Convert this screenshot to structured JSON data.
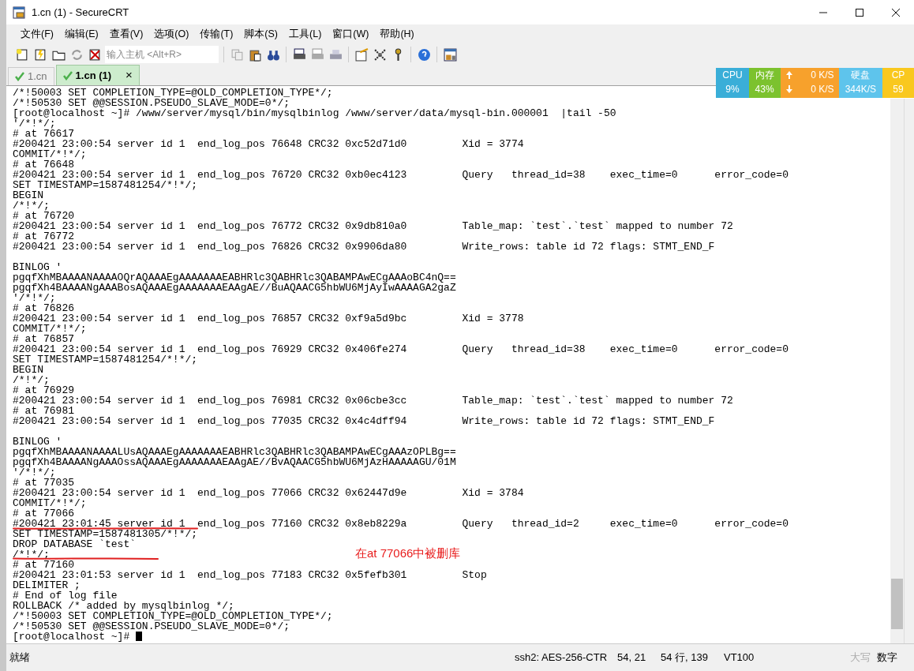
{
  "window": {
    "title": "1.cn (1) - SecureCRT"
  },
  "menu": [
    "文件(F)",
    "编辑(E)",
    "查看(V)",
    "选项(O)",
    "传输(T)",
    "脚本(S)",
    "工具(L)",
    "窗口(W)",
    "帮助(H)"
  ],
  "toolbar": {
    "host_field": {
      "placeholder": "输入主机 <Alt+R>"
    }
  },
  "tabs": [
    {
      "label": "1.cn",
      "selected": false,
      "connected": true
    },
    {
      "label": "1.cn (1)",
      "selected": true,
      "connected": true,
      "close": "×"
    }
  ],
  "monitor": [
    {
      "kind": "meter",
      "label": "CPU",
      "value": "9%",
      "color": "#3aaed8"
    },
    {
      "kind": "meter",
      "label": "内存",
      "value": "43%",
      "color": "#7cc22e"
    },
    {
      "kind": "network",
      "up": "0 K/S",
      "down": "0 K/S",
      "color": "#f7a12c"
    },
    {
      "kind": "meter",
      "label": "硬盘",
      "value": "344K/S",
      "color": "#5ec4ec"
    },
    {
      "kind": "meter",
      "label": "CP",
      "value": "59",
      "color": "#f9c81e"
    }
  ],
  "terminal": {
    "lines": [
      {
        "text": "/*!50003 SET COMPLETION_TYPE=@OLD_COMPLETION_TYPE*/;"
      },
      {
        "text": "/*!50530 SET @@SESSION.PSEUDO_SLAVE_MODE=0*/;"
      },
      {
        "text": "[root@localhost ~]# /www/server/mysql/bin/mysqlbinlog /www/server/data/mysql-bin.000001  |tail -50"
      },
      {
        "text": "'/*!*/;"
      },
      {
        "text": "# at 76617"
      },
      {
        "text": "#200421 23:00:54 server id 1  end_log_pos 76648 CRC32 0xc52d71d0         Xid = 3774"
      },
      {
        "text": "COMMIT/*!*/;"
      },
      {
        "text": "# at 76648"
      },
      {
        "text": "#200421 23:00:54 server id 1  end_log_pos 76720 CRC32 0xb0ec4123         Query   thread_id=38    exec_time=0      error_code=0"
      },
      {
        "text": "SET TIMESTAMP=1587481254/*!*/;"
      },
      {
        "text": "BEGIN"
      },
      {
        "text": "/*!*/;"
      },
      {
        "text": "# at 76720"
      },
      {
        "text": "#200421 23:00:54 server id 1  end_log_pos 76772 CRC32 0x9db810a0         Table_map: `test`.`test` mapped to number 72"
      },
      {
        "text": "# at 76772"
      },
      {
        "text": "#200421 23:00:54 server id 1  end_log_pos 76826 CRC32 0x9906da80         Write_rows: table id 72 flags: STMT_END_F"
      },
      {
        "text": "BINLOG '",
        "gap_before": true
      },
      {
        "text": "pgqfXhMBAAAANAAAAOQrAQAAAEgAAAAAAAEABHRlc3QABHRlc3QABAMPAwECgAAAoBC4nQ=="
      },
      {
        "text": "pgqfXh4BAAAANgAAABosAQAAAEgAAAAAAAEAAgAE//BuAQAACG5hbWU6MjAyIwAAAAGA2gaZ"
      },
      {
        "text": "'/*!*/;"
      },
      {
        "text": "# at 76826"
      },
      {
        "text": "#200421 23:00:54 server id 1  end_log_pos 76857 CRC32 0xf9a5d9bc         Xid = 3778"
      },
      {
        "text": "COMMIT/*!*/;"
      },
      {
        "text": "# at 76857"
      },
      {
        "text": "#200421 23:00:54 server id 1  end_log_pos 76929 CRC32 0x406fe274         Query   thread_id=38    exec_time=0      error_code=0"
      },
      {
        "text": "SET TIMESTAMP=1587481254/*!*/;"
      },
      {
        "text": "BEGIN"
      },
      {
        "text": "/*!*/;"
      },
      {
        "text": "# at 76929"
      },
      {
        "text": "#200421 23:00:54 server id 1  end_log_pos 76981 CRC32 0x06cbe3cc         Table_map: `test`.`test` mapped to number 72"
      },
      {
        "text": "# at 76981"
      },
      {
        "text": "#200421 23:00:54 server id 1  end_log_pos 77035 CRC32 0x4c4dff94         Write_rows: table id 72 flags: STMT_END_F"
      },
      {
        "text": "BINLOG '",
        "gap_before": true
      },
      {
        "text": "pgqfXhMBAAAANAAAALUsAQAAAEgAAAAAAAEABHRlc3QABHRlc3QABAMPAwECgAAAzOPLBg=="
      },
      {
        "text": "pgqfXh4BAAAANgAAAOssAQAAAEgAAAAAAAEAAgAE//BvAQAACG5hbWU6MjAzHAAAAAGU/01M"
      },
      {
        "text": "'/*!*/;"
      },
      {
        "text": "# at 77035"
      },
      {
        "text": "#200421 23:00:54 server id 1  end_log_pos 77066 CRC32 0x62447d9e         Xid = 3784"
      },
      {
        "text": "COMMIT/*!*/;"
      },
      {
        "text": "# at 77066"
      },
      {
        "text": "#200421 23:01:45 server id 1  end_log_pos 77160 CRC32 0x8eb8229a         Query   thread_id=2     exec_time=0      error_code=0"
      },
      {
        "text": "SET TIMESTAMP=1587481305/*!*/;"
      },
      {
        "text": "DROP DATABASE `test`"
      },
      {
        "text": "/*!*/;"
      },
      {
        "text": "# at 77160"
      },
      {
        "text": "#200421 23:01:53 server id 1  end_log_pos 77183 CRC32 0x5fefb301         Stop"
      },
      {
        "text": "DELIMITER ;"
      },
      {
        "text": "# End of log file"
      },
      {
        "text": "ROLLBACK /* added by mysqlbinlog */;"
      },
      {
        "text": "/*!50003 SET COMPLETION_TYPE=@OLD_COMPLETION_TYPE*/;"
      },
      {
        "text": "/*!50530 SET @@SESSION.PSEUDO_SLAVE_MODE=0*/;"
      },
      {
        "text": "[root@localhost ~]# ",
        "cursor": true
      }
    ],
    "annotation": "在at 77066中被删库"
  },
  "status_bar": [
    {
      "text": "就绪",
      "dim": false
    },
    {
      "text": "ssh2: AES-256-CTR",
      "dim": false
    },
    {
      "text": "54,  21",
      "dim": false
    },
    {
      "text": "54 行, 139",
      "dim": false
    },
    {
      "text": "VT100",
      "dim": false
    },
    {
      "text": "大写",
      "dim": true
    },
    {
      "text": "数字",
      "dim": false
    }
  ]
}
